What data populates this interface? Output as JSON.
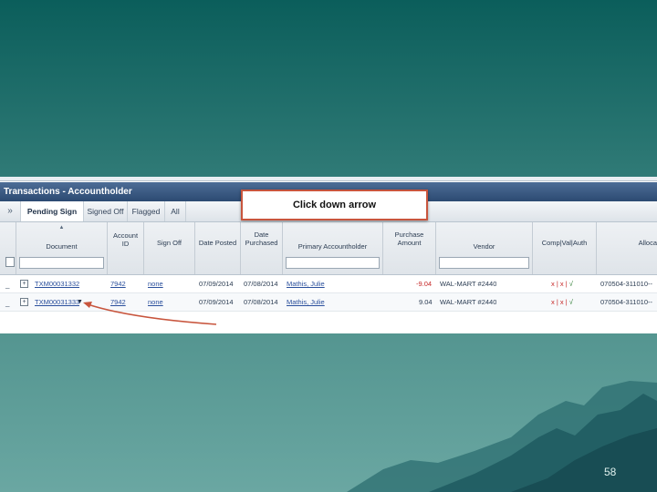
{
  "window": {
    "title": "Transactions - Accountholder",
    "expand_icon": "double-chevron-right-icon",
    "expand_glyph": "»"
  },
  "tabs": [
    {
      "label": "Pending Sign Off",
      "active": true
    },
    {
      "label": "Signed Off",
      "active": false
    },
    {
      "label": "Flagged",
      "active": false
    },
    {
      "label": "All",
      "active": false
    }
  ],
  "columns": [
    {
      "line1": "",
      "line2": "Document",
      "sorted": true,
      "filter": true
    },
    {
      "line1": "Account",
      "line2": "ID",
      "sorted": false,
      "filter": false
    },
    {
      "line1": "",
      "line2": "Sign Off",
      "sorted": false,
      "filter": false
    },
    {
      "line1": "",
      "line2": "Date Posted",
      "sorted": false,
      "filter": false
    },
    {
      "line1": "Date",
      "line2": "Purchased",
      "sorted": false,
      "filter": false
    },
    {
      "line1": "",
      "line2": "Primary Accountholder",
      "sorted": false,
      "filter": true
    },
    {
      "line1": "Purchase",
      "line2": "Amount",
      "sorted": false,
      "filter": false
    },
    {
      "line1": "",
      "line2": "Vendor",
      "sorted": false,
      "filter": true
    },
    {
      "line1": "",
      "line2": "Comp|Val|Auth",
      "sorted": false,
      "filter": false
    },
    {
      "line1": "",
      "line2": "Alloca",
      "sorted": false,
      "filter": false
    }
  ],
  "rows": [
    {
      "document": "TXM00031332",
      "account_id": "7942",
      "sign_off": "none",
      "date_posted": "07/09/2014",
      "date_purchased": "07/08/2014",
      "accountholder": "Mathis, Julie",
      "amount": "-9.04",
      "vendor": "WAL-MART #2440",
      "flags": "x | x | ",
      "check": "√",
      "allocation": "070504-311010--"
    },
    {
      "document": "TXM00031333",
      "account_id": "7942",
      "sign_off": "none",
      "date_posted": "07/09/2014",
      "date_purchased": "07/08/2014",
      "accountholder": "Mathis, Julie",
      "amount": "9.04",
      "vendor": "WAL-MART #2440",
      "flags": "x | x | ",
      "check": "√",
      "allocation": "070504-311010--"
    }
  ],
  "row_action_icon": "expand-plus-icon",
  "dropdown_arrow_glyph": "▼",
  "callout": {
    "text": "Click down arrow"
  },
  "slide_number": "58",
  "colors": {
    "title_bar": "#2c4a72",
    "callout_border": "#c8553d",
    "negative": "#c62828",
    "link": "#2a4f9c"
  }
}
